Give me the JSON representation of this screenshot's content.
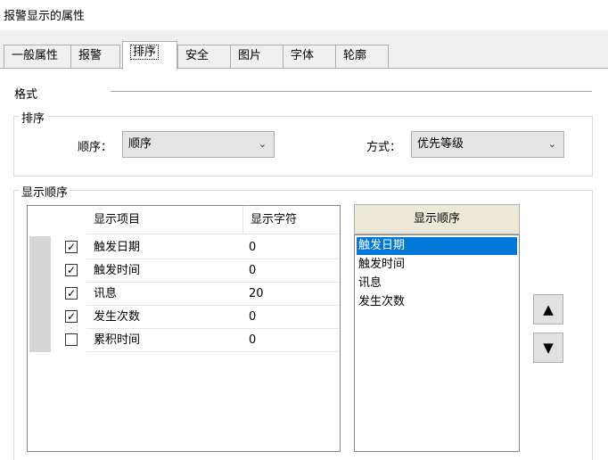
{
  "window": {
    "title": "报警显示的属性"
  },
  "tabs": [
    {
      "label": "一般属性",
      "active": false
    },
    {
      "label": "报警",
      "active": false
    },
    {
      "label": "排序",
      "active": true
    },
    {
      "label": "安全",
      "active": false
    },
    {
      "label": "图片",
      "active": false
    },
    {
      "label": "字体",
      "active": false
    },
    {
      "label": "轮廓",
      "active": false
    }
  ],
  "format": {
    "label": "格式",
    "sort_group": {
      "label": "排序",
      "order_label": "顺序：",
      "order_value": "顺序",
      "mode_label": "方式：",
      "mode_value": "优先等级"
    },
    "display_group": {
      "label": "显示顺序",
      "columns": [
        "显示项目",
        "显示字符"
      ],
      "rows": [
        {
          "checked": true,
          "item": "触发日期",
          "chars": "0"
        },
        {
          "checked": true,
          "item": "触发时间",
          "chars": "0"
        },
        {
          "checked": true,
          "item": "讯息",
          "chars": "20"
        },
        {
          "checked": true,
          "item": "发生次数",
          "chars": "0"
        },
        {
          "checked": false,
          "item": "累积时间",
          "chars": "0"
        }
      ],
      "order_header": "显示顺序",
      "order_list": [
        "触发日期",
        "触发时间",
        "讯息",
        "发生次数"
      ],
      "selected_index": 0,
      "up_icon": "▲",
      "down_icon": "▼"
    }
  }
}
